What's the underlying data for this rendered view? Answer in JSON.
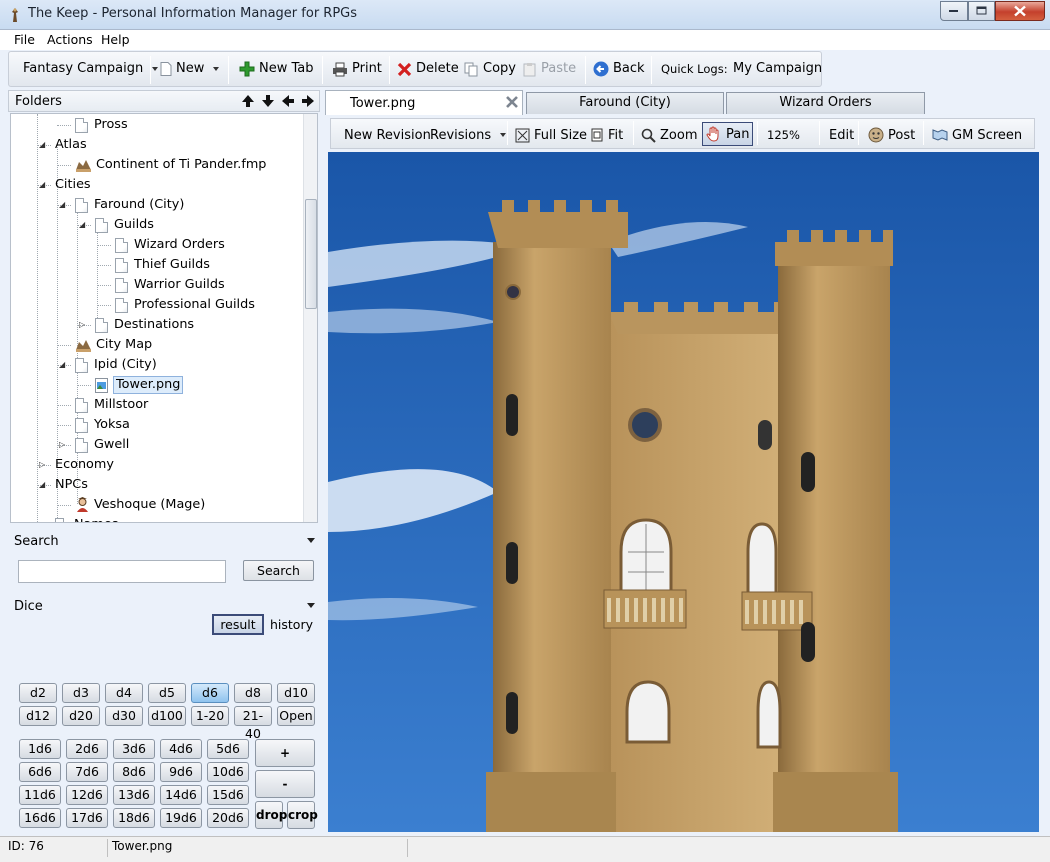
{
  "window": {
    "title": "The Keep - Personal Information Manager for RPGs"
  },
  "menu": [
    "File",
    "Actions",
    "Help"
  ],
  "toolbar": {
    "campaign": "Fantasy Campaign",
    "new": "New",
    "new_tab": "New Tab",
    "print": "Print",
    "delete": "Delete",
    "copy": "Copy",
    "paste": "Paste",
    "back": "Back",
    "quick_logs_label": "Quick Logs:",
    "quick_logs_value": "My Campaign"
  },
  "folders": {
    "title": "Folders",
    "tree": [
      {
        "label": "Pross",
        "icon": "doc"
      },
      {
        "label": "Atlas",
        "icon": "none",
        "expander": "▴"
      },
      {
        "label": "Continent of Ti Pander.fmp",
        "icon": "map"
      },
      {
        "label": "Cities",
        "icon": "none",
        "expander": "▴"
      },
      {
        "label": "Faround (City)",
        "icon": "doc",
        "expander": "▴"
      },
      {
        "label": "Guilds",
        "icon": "doc",
        "expander": "▴"
      },
      {
        "label": "Wizard Orders",
        "icon": "doc"
      },
      {
        "label": "Thief Guilds",
        "icon": "doc"
      },
      {
        "label": "Warrior Guilds",
        "icon": "doc"
      },
      {
        "label": "Professional Guilds",
        "icon": "doc"
      },
      {
        "label": "Destinations",
        "icon": "doc",
        "expander": "▷"
      },
      {
        "label": "City Map",
        "icon": "map"
      },
      {
        "label": "Ipid (City)",
        "icon": "doc",
        "expander": "▴"
      },
      {
        "label": "Tower.png",
        "icon": "image",
        "selected": true
      },
      {
        "label": "Millstoor",
        "icon": "doc"
      },
      {
        "label": "Yoksa",
        "icon": "doc"
      },
      {
        "label": "Gwell",
        "icon": "doc",
        "expander": "▷"
      },
      {
        "label": "Economy",
        "icon": "none",
        "expander": "▷"
      },
      {
        "label": "NPCs",
        "icon": "none",
        "expander": "▴"
      },
      {
        "label": "Veshoque (Mage)",
        "icon": "person"
      },
      {
        "label": "Names",
        "icon": "doc",
        "expander": "▷"
      }
    ]
  },
  "search": {
    "title": "Search",
    "value": "",
    "button": "Search"
  },
  "dice": {
    "title": "Dice",
    "result_label": "result",
    "history_label": "history",
    "row1": [
      "d2",
      "d3",
      "d4",
      "d5",
      "d6",
      "d8",
      "d10"
    ],
    "row2": [
      "d12",
      "d20",
      "d30",
      "d100",
      "1-20",
      "21-40",
      "Open"
    ],
    "multi": [
      [
        "1d6",
        "2d6",
        "3d6",
        "4d6",
        "5d6"
      ],
      [
        "6d6",
        "7d6",
        "8d6",
        "9d6",
        "10d6"
      ],
      [
        "11d6",
        "12d6",
        "13d6",
        "14d6",
        "15d6"
      ],
      [
        "16d6",
        "17d6",
        "18d6",
        "19d6",
        "20d6"
      ]
    ],
    "plus": "+",
    "minus": "-",
    "drop": "drop",
    "crop": "crop",
    "selected": "d6"
  },
  "tabs": [
    "Tower.png",
    "Faround (City)",
    "Wizard Orders"
  ],
  "image_toolbar": {
    "new_revision": "New Revision",
    "revisions": "Revisions",
    "full_size": "Full Size",
    "fit": "Fit",
    "zoom": "Zoom",
    "pan": "Pan",
    "zoom_level": "125%",
    "edit": "Edit",
    "post": "Post",
    "gm_screen": "GM Screen"
  },
  "status": {
    "id": "ID: 76",
    "name": "Tower.png"
  }
}
